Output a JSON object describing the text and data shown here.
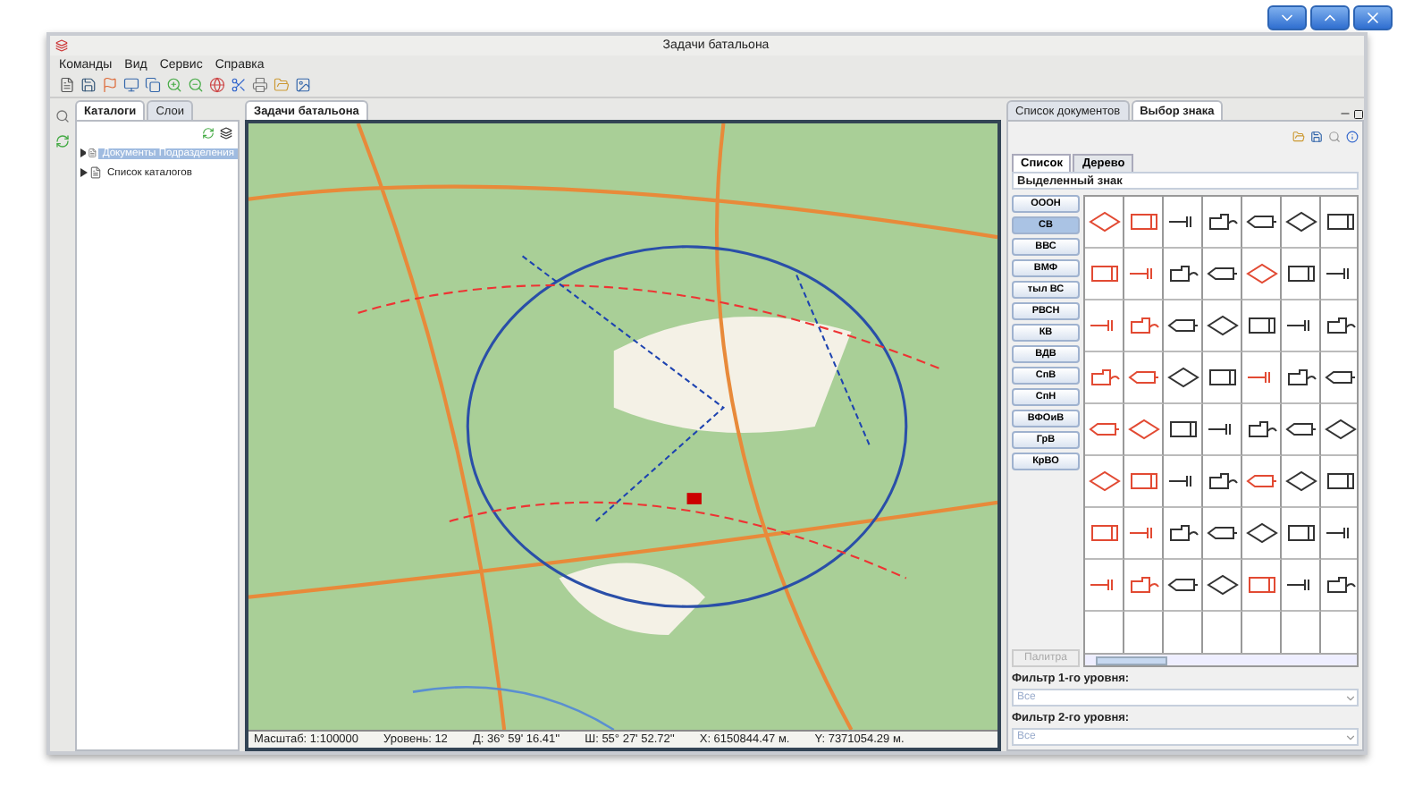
{
  "window": {
    "title": "Задачи батальона"
  },
  "menu": [
    "Команды",
    "Вид",
    "Сервис",
    "Справка"
  ],
  "left_panel": {
    "tabs": [
      {
        "label": "Каталоги",
        "selected": true
      },
      {
        "label": "Слои",
        "selected": false
      }
    ],
    "tree": [
      {
        "label": "Документы Подразделения",
        "selected": true
      },
      {
        "label": "Список каталогов",
        "selected": false
      }
    ]
  },
  "editor": {
    "tabs": [
      {
        "label": "Задачи батальона",
        "selected": true
      }
    ],
    "status_bar": [
      "Масштаб: 1:100000",
      "Уровень: 12",
      "Д: 36° 59' 16.41''",
      "Ш: 55° 27' 52.72''",
      "X: 6150844.47 м.",
      "Y: 7371054.29 м."
    ]
  },
  "right_panel": {
    "tabs": [
      {
        "label": "Список документов",
        "selected": false
      },
      {
        "label": "Выбор знака",
        "selected": true
      }
    ],
    "view_tabs": [
      {
        "label": "Список",
        "selected": true
      },
      {
        "label": "Дерево",
        "selected": false
      }
    ],
    "selected_sign_label": "Выделенный знак",
    "categories": [
      {
        "label": "ОООН",
        "selected": false
      },
      {
        "label": "СВ",
        "selected": true
      },
      {
        "label": "ВВС",
        "selected": false
      },
      {
        "label": "ВМФ",
        "selected": false
      },
      {
        "label": "тыл ВС",
        "selected": false
      },
      {
        "label": "РВСН",
        "selected": false
      },
      {
        "label": "КВ",
        "selected": false
      },
      {
        "label": "ВДВ",
        "selected": false
      },
      {
        "label": "СпВ",
        "selected": false
      },
      {
        "label": "СпН",
        "selected": false
      },
      {
        "label": "ВФОиВ",
        "selected": false
      },
      {
        "label": "ГрВ",
        "selected": false
      },
      {
        "label": "КрВО",
        "selected": false
      }
    ],
    "palette_button": {
      "label": "Палитра",
      "disabled": true
    },
    "filters": [
      {
        "label": "Фильтр 1-го уровня:",
        "value": "Все"
      },
      {
        "label": "Фильтр 2-го уровня:",
        "value": "Все"
      }
    ]
  }
}
